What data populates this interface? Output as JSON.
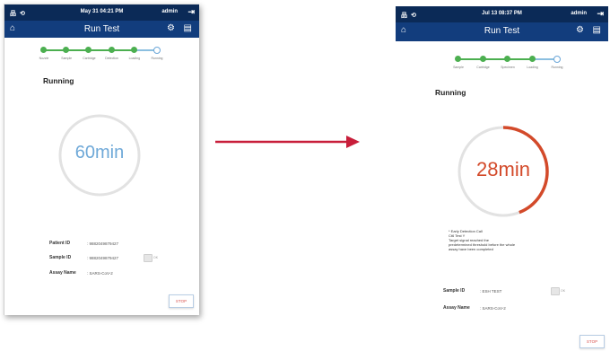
{
  "colors": {
    "status_bar": "#0b2a57",
    "title_bar": "#123d7d",
    "step_complete": "#4caf50",
    "ring_track": "#e2e2e2",
    "ring_progress": "#d34a2a",
    "left_minutes_text": "#6fa9d8",
    "right_minutes_text": "#d34a2a",
    "arrow": "#c81e3a",
    "stop_text": "#d9534f"
  },
  "left": {
    "status": {
      "network": "品 ⟲",
      "datetime": "May 31   04:21 PM",
      "user": "admin"
    },
    "title": "Run Test",
    "icons": {
      "home": "home-icon",
      "settings": "gear-icon",
      "clipboard": "clipboard-icon",
      "logout": "logout-icon"
    },
    "steps": [
      "Nozzle",
      "Sample",
      "Cartridge",
      "Detection",
      "Loading",
      "Running"
    ],
    "heading": "Running",
    "minutes": "60min",
    "patient_id_label": "Patient ID",
    "patient_id_value": ": 9882049879427",
    "sample_id_label": "Sample ID",
    "sample_id_value": ": 9882049879427",
    "toggle_label": "OK",
    "assay_name_label": "Assay Name",
    "assay_name_value": ": SARS-CoV-2",
    "stop_label": "STOP"
  },
  "right": {
    "status": {
      "network": "品 ⟲",
      "datetime": "Jul 13   08:37 PM",
      "user": "admin"
    },
    "title": "Run Test",
    "icons": {
      "home": "home-icon",
      "settings": "gear-icon",
      "clipboard": "clipboard-icon",
      "logout": "logout-icon"
    },
    "steps": [
      "Sample",
      "Cartridge",
      "Specimen",
      "Loading",
      "Running"
    ],
    "heading": "Running",
    "minutes": "28min",
    "progress_fraction": 0.44,
    "note": [
      "* Early Detection Call",
      "Ct6 Test Y",
      "Target signal reached the",
      "predetermined threshold before the whole",
      "assay have been completed"
    ],
    "sample_id_label": "Sample ID",
    "sample_id_value": ": ESH TEST",
    "toggle_label": "OK",
    "assay_name_label": "Assay Name",
    "assay_name_value": ": SARS-CoV-2",
    "stop_label": "STOP"
  }
}
